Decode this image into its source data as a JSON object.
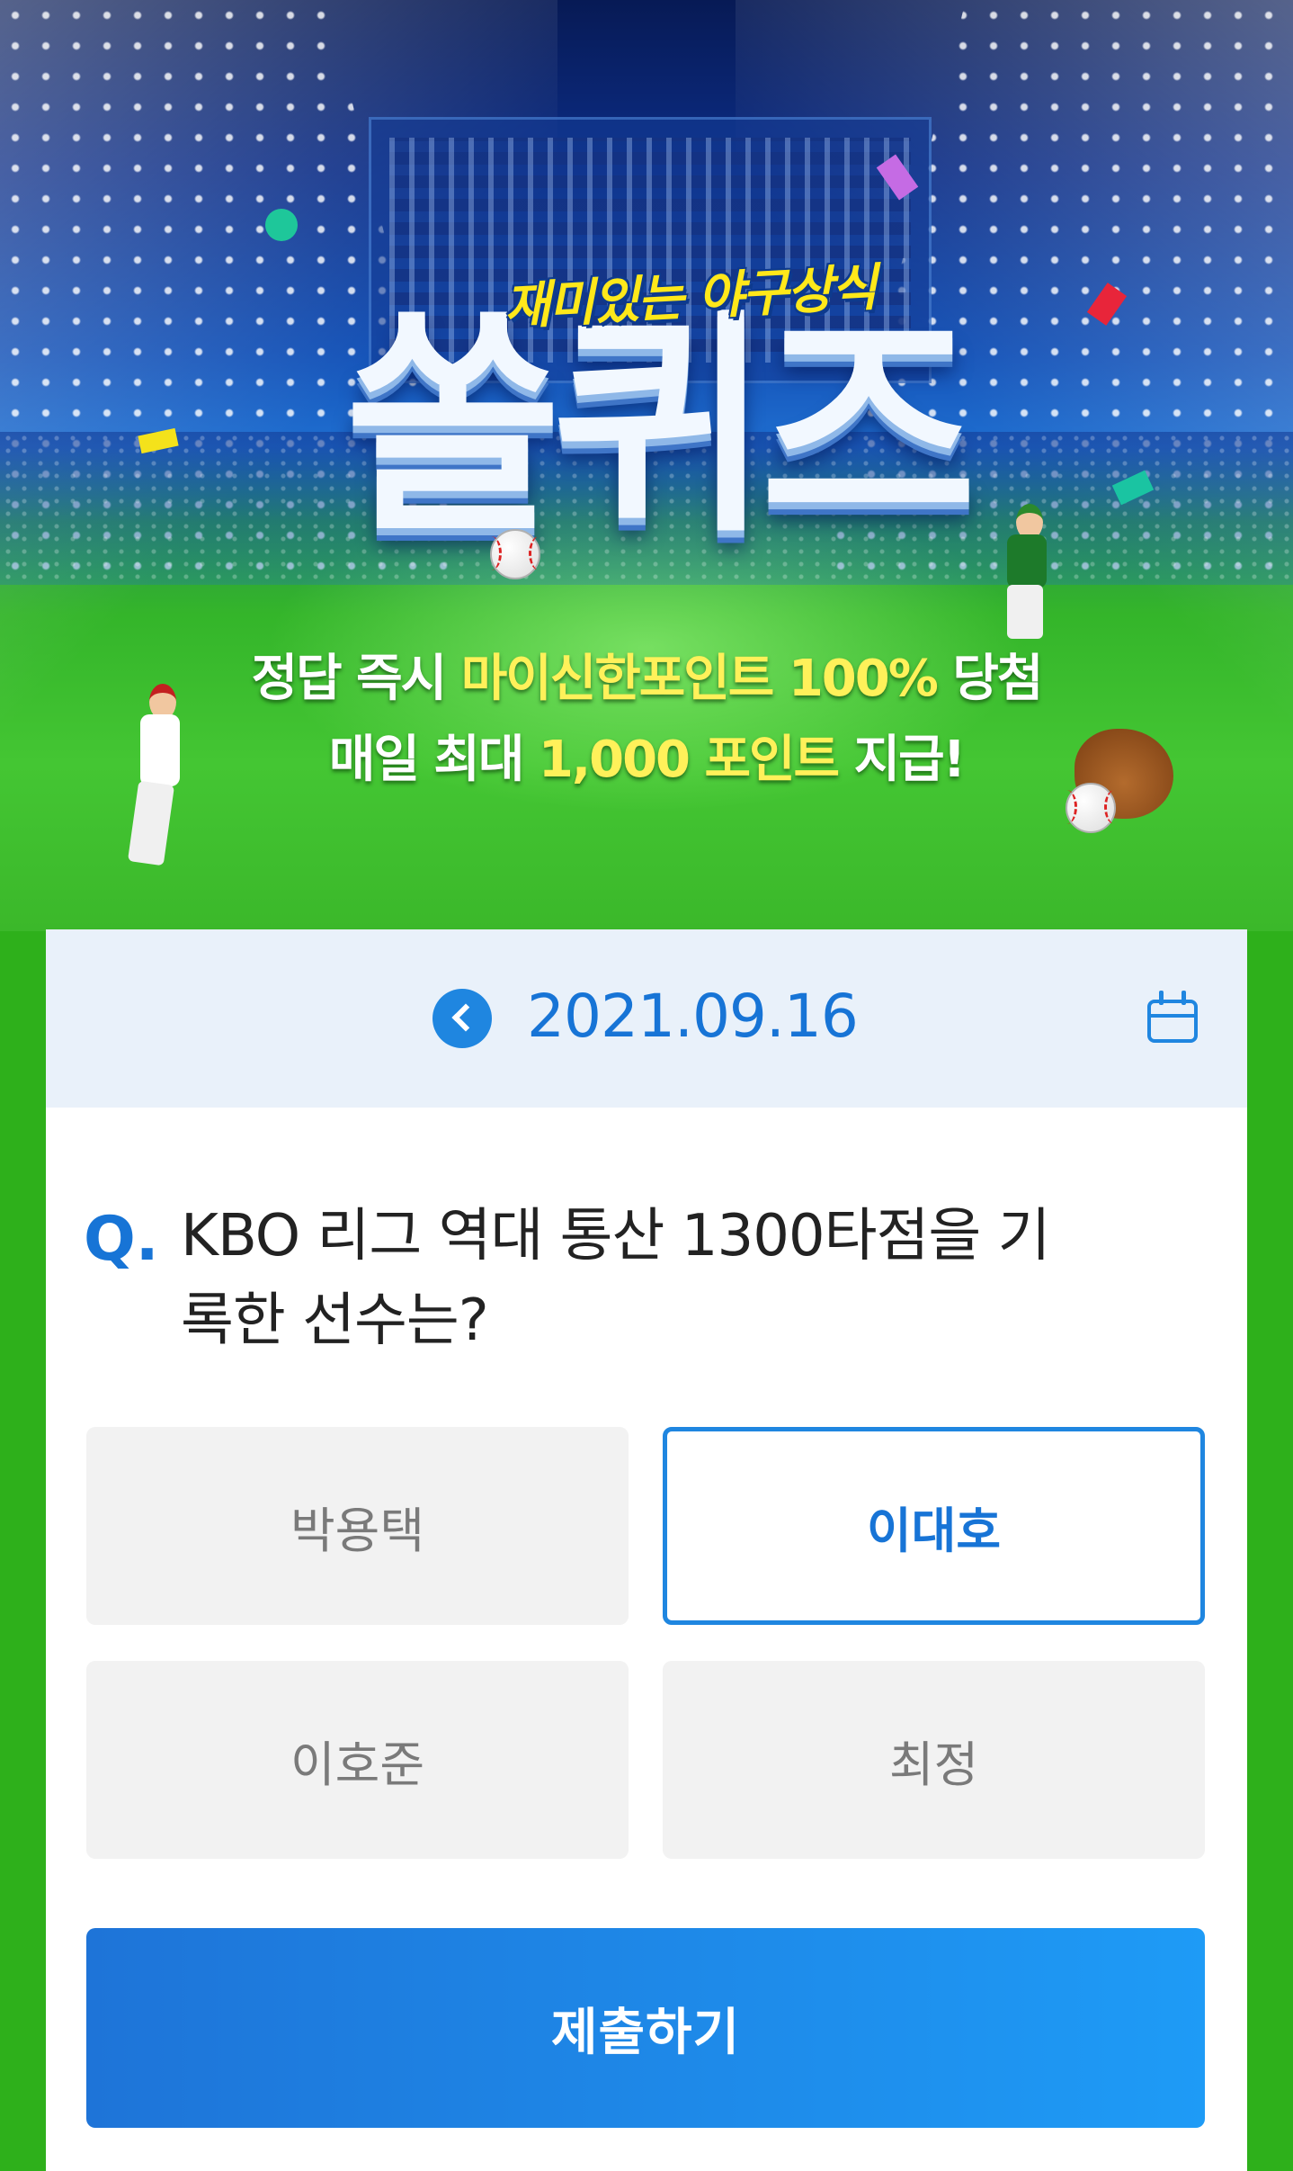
{
  "banner": {
    "subtitle": "재미있는 야구상식",
    "logo_text": "쏠퀴즈",
    "promo_line1_prefix": "정답 즉시 ",
    "promo_line1_highlight": "마이신한포인트 100%",
    "promo_line1_suffix": " 당첨",
    "promo_line2_prefix": "매일 최대 ",
    "promo_line2_highlight": "1,000 포인트",
    "promo_line2_suffix": " 지급!"
  },
  "date_bar": {
    "date": "2021.09.16",
    "prev_icon": "chevron-left-icon",
    "calendar_icon": "calendar-icon"
  },
  "question": {
    "marker": "Q.",
    "line1": "KBO 리그 역대 통산 1300타점을 기",
    "line2": "록한 선수는?"
  },
  "options": [
    {
      "label": "박용택",
      "selected": false
    },
    {
      "label": "이대호",
      "selected": true
    },
    {
      "label": "이호준",
      "selected": false
    },
    {
      "label": "최정",
      "selected": false
    }
  ],
  "submit": {
    "label": "제출하기"
  },
  "colors": {
    "accent": "#1f86e0",
    "date_bar_bg": "#e9f1fa",
    "highlight_text": "#fff15a",
    "subtitle_yellow": "#ffe81a",
    "field_green": "#2eb01b"
  }
}
